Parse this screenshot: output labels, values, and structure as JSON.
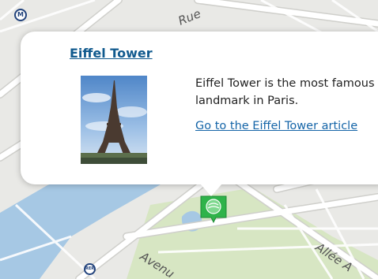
{
  "map": {
    "labels": {
      "street_top": "Rue",
      "street_bottom_left": "Avenu",
      "street_bottom_right": "Allée A"
    },
    "badges": {
      "metro": "M",
      "rer": "RER"
    },
    "colors": {
      "land": "#e9e9e6",
      "water": "#a6c8e4",
      "park": "#d7e6c3",
      "road": "#ffffff",
      "road_edge": "#cfcfcb",
      "marker": "#2fb34a",
      "link": "#1565a8",
      "title": "#115a8e"
    }
  },
  "popup": {
    "title": "Eiffel Tower",
    "description": "Eiffel Tower is the most famous landmark in Paris.",
    "link_text": "Go to the Eiffel Tower article",
    "photo_alt": "Eiffel Tower photo"
  },
  "marker": {
    "icon": "map-pin-icon"
  }
}
